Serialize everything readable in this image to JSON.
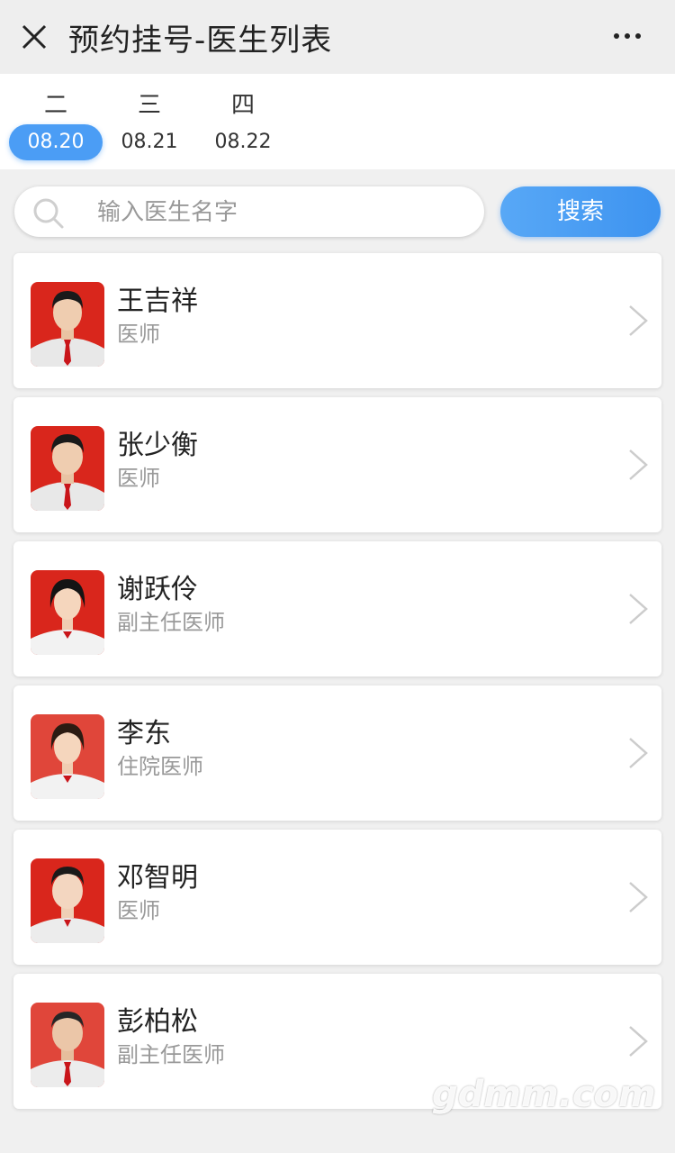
{
  "header": {
    "title": "预约挂号-医生列表",
    "close_icon": "close-icon",
    "more_icon": "more-dots-icon"
  },
  "dates": [
    {
      "weekday": "二",
      "date": "08.20",
      "selected": true
    },
    {
      "weekday": "三",
      "date": "08.21",
      "selected": false
    },
    {
      "weekday": "四",
      "date": "08.22",
      "selected": false
    }
  ],
  "search": {
    "placeholder": "输入医生名字",
    "value": "",
    "button_label": "搜索",
    "icon": "search-icon"
  },
  "doctors": [
    {
      "name": "王吉祥",
      "title": "医师",
      "gender": "male"
    },
    {
      "name": "张少衡",
      "title": "医师",
      "gender": "male"
    },
    {
      "name": "谢跃伶",
      "title": "副主任医师",
      "gender": "female"
    },
    {
      "name": "李东",
      "title": "住院医师",
      "gender": "female"
    },
    {
      "name": "邓智明",
      "title": "医师",
      "gender": "male"
    },
    {
      "name": "彭柏松",
      "title": "副主任医师",
      "gender": "male"
    }
  ],
  "watermark": "gdmm.com",
  "colors": {
    "accent": "#4b9df5",
    "photo_background": "#d9261c"
  }
}
